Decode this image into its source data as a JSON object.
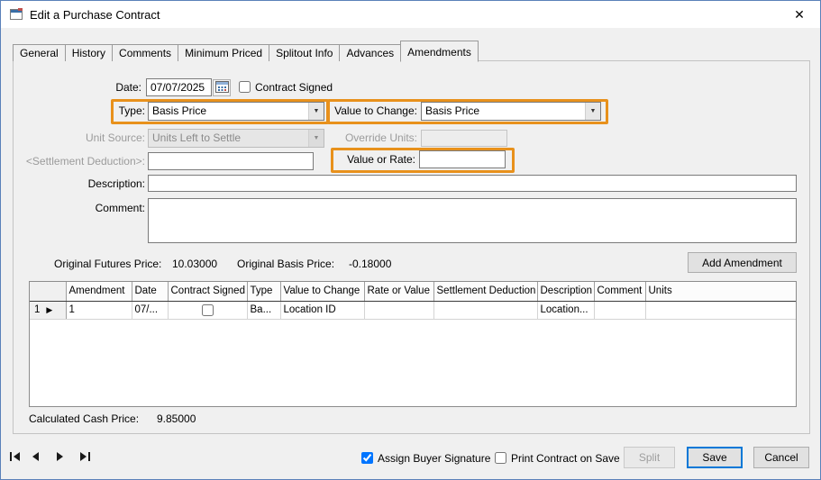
{
  "window": {
    "title": "Edit a Purchase Contract"
  },
  "icons": {
    "close": "✕",
    "dropdown_arrow": "▼",
    "row_selector": "▶"
  },
  "tabs": {
    "items": [
      {
        "label": "General"
      },
      {
        "label": "History"
      },
      {
        "label": "Comments"
      },
      {
        "label": "Minimum Priced"
      },
      {
        "label": "Splitout Info"
      },
      {
        "label": "Advances"
      },
      {
        "label": "Amendments"
      }
    ],
    "active": "Amendments"
  },
  "form": {
    "date_label": "Date:",
    "date_value": "07/07/2025",
    "contract_signed_label": "Contract Signed",
    "contract_signed_checked": false,
    "type_label": "Type:",
    "type_value": "Basis Price",
    "value_to_change_label": "Value to Change:",
    "value_to_change_value": "Basis Price",
    "unit_source_label": "Unit Source:",
    "unit_source_value": "Units Left to Settle",
    "override_units_label": "Override Units:",
    "override_units_value": "",
    "settlement_deduction_label": "<Settlement Deduction>:",
    "settlement_deduction_value": "",
    "value_or_rate_label": "Value or Rate:",
    "value_or_rate_value": "",
    "description_label": "Description:",
    "description_value": "",
    "comment_label": "Comment:",
    "comment_value": ""
  },
  "summary": {
    "original_futures_price_label": "Original Futures Price:",
    "original_futures_price_value": "10.03000",
    "original_basis_price_label": "Original Basis Price:",
    "original_basis_price_value": "-0.18000",
    "add_amendment_button": "Add Amendment",
    "calculated_cash_price_label": "Calculated Cash Price:",
    "calculated_cash_price_value": "9.85000"
  },
  "grid": {
    "columns": [
      "Amendment",
      "Date",
      "Contract Signed",
      "Type",
      "Value to Change",
      "Rate or Value",
      "Settlement Deduction",
      "Description",
      "Comment",
      "Units"
    ],
    "rows": [
      {
        "row_number": "1",
        "amendment": "1",
        "date": "07/...",
        "contract_signed": false,
        "type": "Ba...",
        "value_to_change": "Location ID",
        "rate_or_value": "",
        "settlement_deduction": "",
        "description": "Location...",
        "comment": "",
        "units": ""
      }
    ]
  },
  "footer": {
    "assign_buyer_signature_label": "Assign Buyer Signature",
    "assign_buyer_signature_checked": true,
    "print_contract_on_save_label": "Print Contract on Save",
    "print_contract_on_save_checked": false,
    "split_button": "Split",
    "save_button": "Save",
    "cancel_button": "Cancel"
  },
  "colors": {
    "highlight": "#E8911C",
    "save_default_border": "#0078D7"
  }
}
